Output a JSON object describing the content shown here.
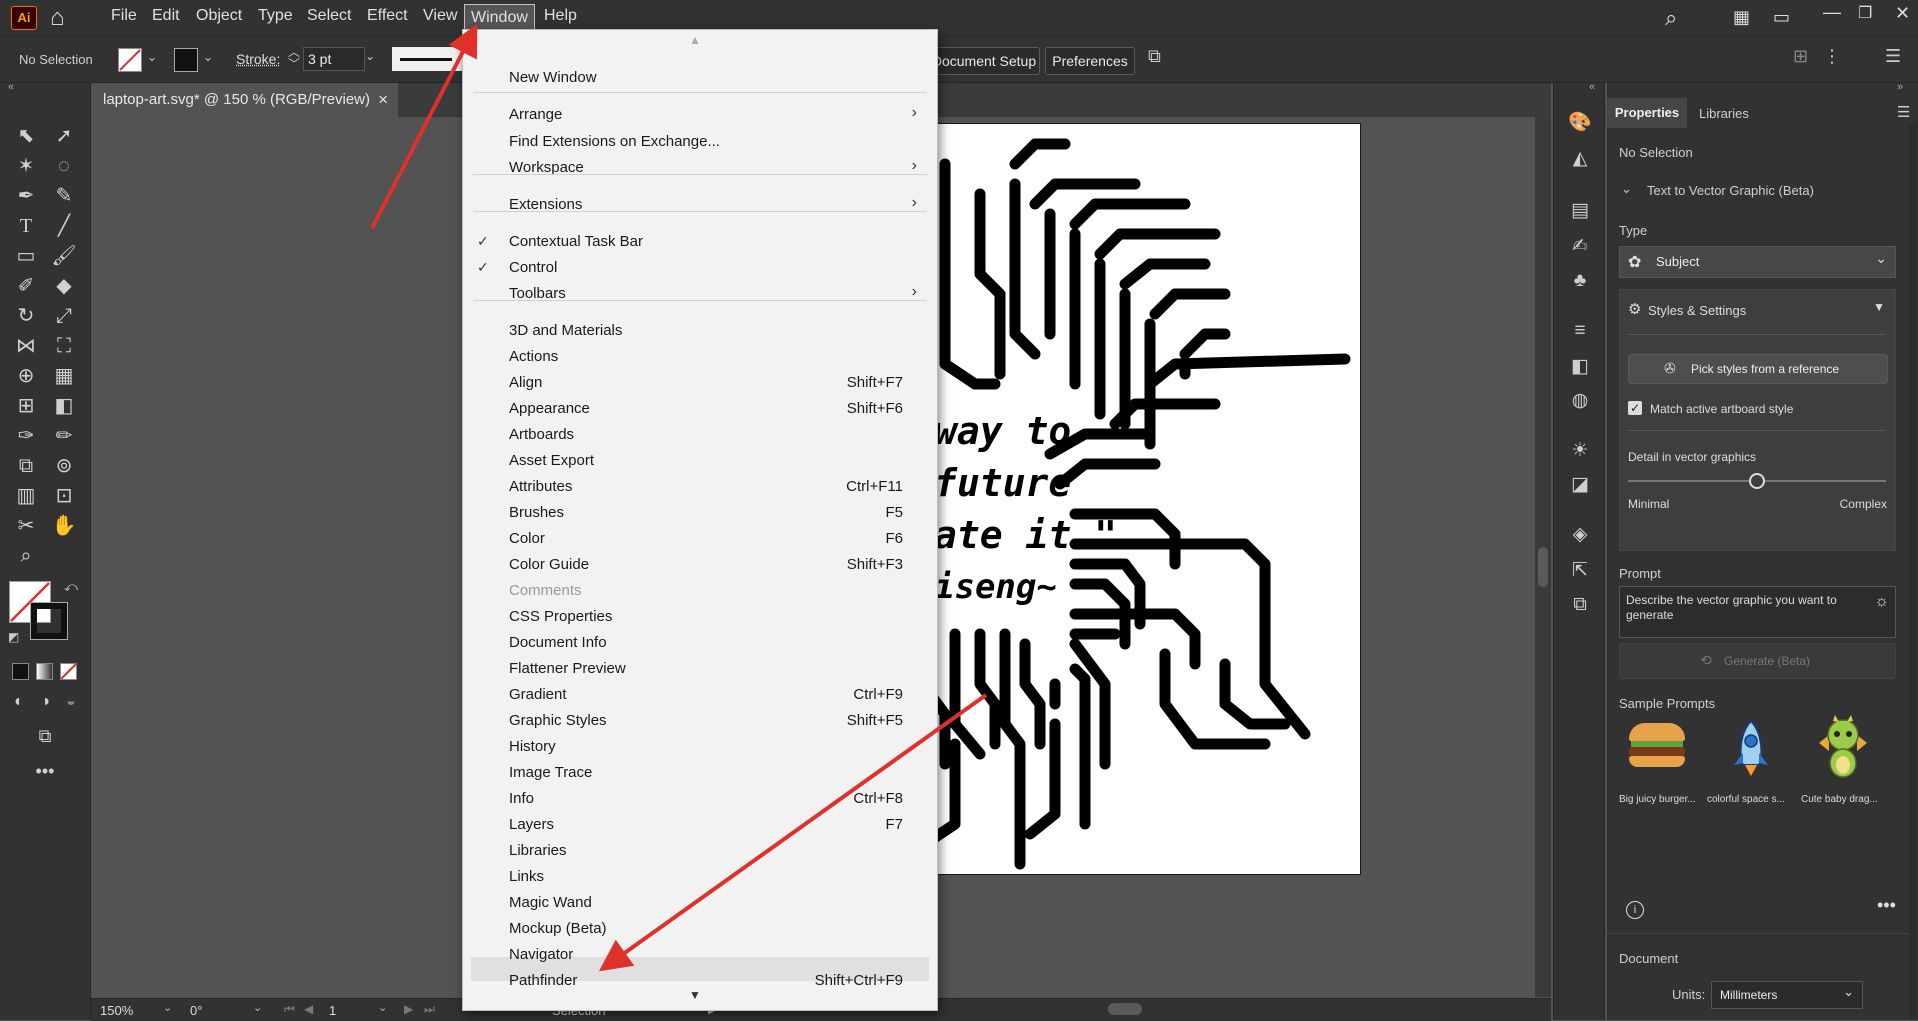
{
  "menubar": {
    "items": [
      "File",
      "Edit",
      "Object",
      "Type",
      "Select",
      "Effect",
      "View",
      "Window",
      "Help"
    ],
    "app_logo": "Ai"
  },
  "controlbar": {
    "selection": "No Selection",
    "stroke_label": "Stroke:",
    "stroke_value": "3 pt",
    "document_setup": "Document Setup",
    "preferences": "Preferences"
  },
  "document": {
    "tab_title": "laptop-art.svg* @ 150 % (RGB/Preview)",
    "close": "×",
    "quote_lines": [
      "way to",
      "future",
      "ate it.\"",
      "iseng~"
    ]
  },
  "statusbar": {
    "zoom": "150%",
    "rotate": "0°",
    "artboard": "1",
    "mode": "Selection"
  },
  "window_menu": {
    "items": [
      {
        "label": "New Window"
      },
      {
        "label": "Arrange",
        "submenu": true
      },
      {
        "label": "Find Extensions on Exchange..."
      },
      {
        "label": "Workspace",
        "submenu": true
      },
      {
        "label": "Extensions",
        "submenu": true
      },
      {
        "label": "Contextual Task Bar",
        "checked": true
      },
      {
        "label": "Control",
        "checked": true
      },
      {
        "label": "Toolbars",
        "submenu": true
      },
      {
        "label": "3D and Materials"
      },
      {
        "label": "Actions"
      },
      {
        "label": "Align",
        "shortcut": "Shift+F7"
      },
      {
        "label": "Appearance",
        "shortcut": "Shift+F6"
      },
      {
        "label": "Artboards"
      },
      {
        "label": "Asset Export"
      },
      {
        "label": "Attributes",
        "shortcut": "Ctrl+F11"
      },
      {
        "label": "Brushes",
        "shortcut": "F5"
      },
      {
        "label": "Color",
        "shortcut": "F6"
      },
      {
        "label": "Color Guide",
        "shortcut": "Shift+F3"
      },
      {
        "label": "Comments",
        "disabled": true
      },
      {
        "label": "CSS Properties"
      },
      {
        "label": "Document Info"
      },
      {
        "label": "Flattener Preview"
      },
      {
        "label": "Gradient",
        "shortcut": "Ctrl+F9"
      },
      {
        "label": "Graphic Styles",
        "shortcut": "Shift+F5"
      },
      {
        "label": "History"
      },
      {
        "label": "Image Trace"
      },
      {
        "label": "Info",
        "shortcut": "Ctrl+F8"
      },
      {
        "label": "Layers",
        "shortcut": "F7"
      },
      {
        "label": "Libraries"
      },
      {
        "label": "Links"
      },
      {
        "label": "Magic Wand"
      },
      {
        "label": "Mockup (Beta)"
      },
      {
        "label": "Navigator"
      },
      {
        "label": "Pathfinder",
        "shortcut": "Shift+Ctrl+F9",
        "highlighted": true
      }
    ]
  },
  "panel": {
    "tabs": [
      "Properties",
      "Libraries"
    ],
    "no_selection": "No Selection",
    "section_title": "Text to Vector Graphic (Beta)",
    "type_label": "Type",
    "type_value": "Subject",
    "styles_settings": "Styles & Settings",
    "pick_styles": "Pick styles from a reference",
    "match_artboard": "Match active artboard style",
    "detail_label": "Detail in vector graphics",
    "detail_min": "Minimal",
    "detail_max": "Complex",
    "detail_level": 0.5,
    "prompt_label": "Prompt",
    "prompt_placeholder": "Describe the vector graphic you want to generate",
    "generate": "Generate (Beta)",
    "sample_prompts_label": "Sample Prompts",
    "samples": [
      "Big juicy burger...",
      "colorful space s...",
      "Cute baby drag..."
    ],
    "document_label": "Document",
    "units_label": "Units:",
    "units_value": "Millimeters"
  },
  "colors": {
    "accent_arrow": "#e0302a",
    "menu_bg": "#f2f2f2",
    "ui_dark": "#323232"
  }
}
